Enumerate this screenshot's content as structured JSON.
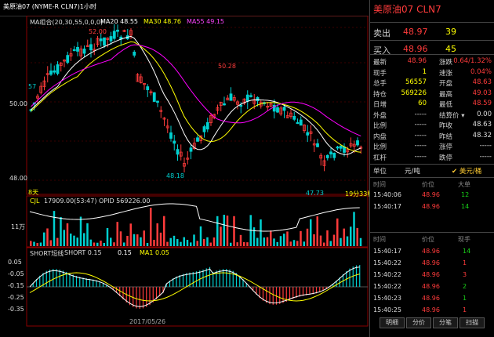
{
  "window": {
    "title": "美原油07 (NYME-R CLN7)1小时"
  },
  "main_chart": {
    "ma_label": "MA组合(20,30,55,0,0,0)",
    "ma20_label": "MA20 48.55",
    "ma30_label": "MA30 48.76",
    "ma55_label": "MA55 49.15",
    "price_labels": {
      "high1": "52.00",
      "high2": "50.28",
      "low1": "48.18",
      "low2": "47.73",
      "left_tag": "57"
    },
    "y_ticks": [
      "50.00",
      "48.00"
    ],
    "period_left": "8天",
    "period_right": "19分33秒",
    "colors": {
      "ma20": "#ffffff",
      "ma30": "#ffff00",
      "ma55": "#ff00ff",
      "up": "#ff3b3b",
      "down": "#00d0d0"
    }
  },
  "volume_chart": {
    "label": "CJL",
    "vol_text": "17909.00(53:47)",
    "opid_text": "OPID 569226.00",
    "y_tick": "11万"
  },
  "macd_chart": {
    "label": "SHORT短线",
    "short_text": "SHORT 0.15",
    "val2": "0.15",
    "ma_text": "MA1 0.05",
    "y_ticks": [
      "0.05",
      "-0.05",
      "-0.15",
      "-0.25",
      "-0.35"
    ],
    "x_date": "2017/05/26"
  },
  "right_panel": {
    "title": "美原油07 CLN7",
    "sell": {
      "label": "卖出",
      "price": "48.97",
      "qty": "39"
    },
    "buy": {
      "label": "买入",
      "price": "48.96",
      "qty": "45"
    },
    "stats": [
      {
        "k1": "最新",
        "v1": "48.96",
        "c1": "red",
        "k2": "涨跌",
        "v2": "0.64/1.32%",
        "c2": "red"
      },
      {
        "k1": "现手",
        "v1": "1",
        "c1": "yellow",
        "k2": "速涨",
        "v2": "0.04%",
        "c2": "red"
      },
      {
        "k1": "总手",
        "v1": "56557",
        "c1": "yellow",
        "k2": "开盘",
        "v2": "48.63",
        "c2": "red"
      },
      {
        "k1": "持仓",
        "v1": "569226",
        "c1": "yellow",
        "k2": "最高",
        "v2": "49.03",
        "c2": "red"
      },
      {
        "k1": "日增",
        "v1": "60",
        "c1": "yellow",
        "k2": "最低",
        "v2": "48.59",
        "c2": "red"
      },
      {
        "k1": "外盘",
        "v1": "-----",
        "c1": "white",
        "k2": "结算价 ▾",
        "v2": "0.00",
        "c2": "white"
      },
      {
        "k1": "比例",
        "v1": "-----",
        "c1": "white",
        "k2": "昨收",
        "v2": "48.63",
        "c2": "white"
      },
      {
        "k1": "内盘",
        "v1": "-----",
        "c1": "white",
        "k2": "昨结",
        "v2": "48.32",
        "c2": "white"
      },
      {
        "k1": "比例",
        "v1": "-----",
        "c1": "white",
        "k2": "涨停",
        "v2": "-----",
        "c2": "white"
      },
      {
        "k1": "杠杆",
        "v1": "-----",
        "c1": "white",
        "k2": "跌停",
        "v2": "-----",
        "c2": "white"
      }
    ],
    "unit_row": {
      "label": "单位",
      "value": "元/吨",
      "alt": "✔ 美元/桶"
    },
    "ticks_head": {
      "time": "时间",
      "price": "价位",
      "vol": "大单"
    },
    "ticks": [
      {
        "time": "15:40:06",
        "price": "48.96",
        "vol": "12"
      },
      {
        "time": "15:40:17",
        "price": "48.96",
        "vol": "14"
      }
    ],
    "trades_head": {
      "time": "时间",
      "price": "价位",
      "vol": "现手"
    },
    "trades": [
      {
        "time": "15:40:17",
        "price": "48.96",
        "vol": "14",
        "vc": "green"
      },
      {
        "time": "15:40:22",
        "price": "48.96",
        "vol": "1",
        "vc": "red"
      },
      {
        "time": "15:40:22",
        "price": "48.96",
        "vol": "3",
        "vc": "red"
      },
      {
        "time": "15:40:22",
        "price": "48.96",
        "vol": "2",
        "vc": "green"
      },
      {
        "time": "15:40:23",
        "price": "48.96",
        "vol": "1",
        "vc": "green"
      },
      {
        "time": "15:40:25",
        "price": "48.96",
        "vol": "1",
        "vc": "red"
      }
    ],
    "tabs": [
      "明细",
      "分价",
      "分笔",
      "扫描"
    ]
  }
}
